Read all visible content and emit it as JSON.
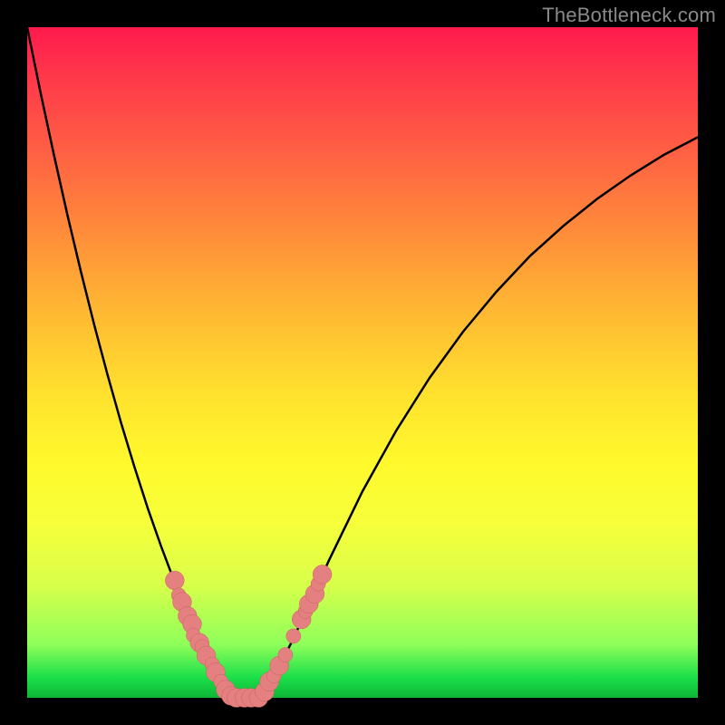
{
  "watermark": "TheBottleneck.com",
  "colors": {
    "page_bg": "#000000",
    "gradient_top": "#ff1a4d",
    "gradient_bottom": "#0db535",
    "curve": "#000000",
    "marker_fill": "#e58080",
    "marker_stroke": "#c96060"
  },
  "chart_data": {
    "type": "line",
    "title": "",
    "xlabel": "",
    "ylabel": "",
    "xlim": [
      0,
      100
    ],
    "ylim": [
      0,
      100
    ],
    "grid": false,
    "x": [
      0,
      2,
      4,
      6,
      8,
      10,
      12,
      14,
      16,
      18,
      20,
      22,
      24,
      25,
      26,
      28,
      30,
      31,
      32,
      33,
      34,
      35,
      36,
      38,
      40,
      42,
      45,
      50,
      55,
      60,
      65,
      70,
      75,
      80,
      85,
      90,
      95,
      100
    ],
    "y": [
      100,
      90.2,
      80.9,
      72.0,
      63.6,
      55.6,
      48.1,
      41.0,
      34.4,
      28.2,
      22.5,
      17.2,
      12.4,
      10.1,
      8.0,
      4.1,
      0.6,
      0.0,
      0.0,
      0.0,
      0.0,
      0.4,
      1.9,
      5.4,
      9.5,
      13.9,
      20.5,
      30.8,
      39.8,
      47.7,
      54.6,
      60.6,
      65.9,
      70.4,
      74.4,
      77.9,
      81.0,
      83.6
    ],
    "markers": [
      {
        "x": 22.0,
        "y": 17.5,
        "r": 1.4
      },
      {
        "x": 22.6,
        "y": 15.3,
        "r": 1.1
      },
      {
        "x": 23.1,
        "y": 14.3,
        "r": 1.4
      },
      {
        "x": 23.9,
        "y": 12.2,
        "r": 1.4
      },
      {
        "x": 24.6,
        "y": 11.0,
        "r": 1.4
      },
      {
        "x": 24.8,
        "y": 9.3,
        "r": 1.1
      },
      {
        "x": 25.7,
        "y": 8.2,
        "r": 1.4
      },
      {
        "x": 26.1,
        "y": 7.6,
        "r": 1.1
      },
      {
        "x": 26.7,
        "y": 6.3,
        "r": 1.4
      },
      {
        "x": 27.6,
        "y": 5.0,
        "r": 1.1
      },
      {
        "x": 28.1,
        "y": 3.8,
        "r": 1.4
      },
      {
        "x": 28.9,
        "y": 2.4,
        "r": 1.1
      },
      {
        "x": 29.6,
        "y": 1.2,
        "r": 1.4
      },
      {
        "x": 30.4,
        "y": 0.3,
        "r": 1.4
      },
      {
        "x": 31.2,
        "y": 0.0,
        "r": 1.4
      },
      {
        "x": 32.4,
        "y": 0.0,
        "r": 1.4
      },
      {
        "x": 33.4,
        "y": 0.0,
        "r": 1.4
      },
      {
        "x": 34.5,
        "y": 0.0,
        "r": 1.4
      },
      {
        "x": 35.4,
        "y": 0.9,
        "r": 1.4
      },
      {
        "x": 36.1,
        "y": 2.4,
        "r": 1.4
      },
      {
        "x": 36.8,
        "y": 3.3,
        "r": 1.1
      },
      {
        "x": 37.6,
        "y": 4.8,
        "r": 1.4
      },
      {
        "x": 38.5,
        "y": 6.4,
        "r": 1.1
      },
      {
        "x": 39.7,
        "y": 9.2,
        "r": 1.1
      },
      {
        "x": 40.9,
        "y": 11.7,
        "r": 1.4
      },
      {
        "x": 41.5,
        "y": 12.9,
        "r": 1.1
      },
      {
        "x": 42.0,
        "y": 14.0,
        "r": 1.4
      },
      {
        "x": 42.9,
        "y": 15.5,
        "r": 1.4
      },
      {
        "x": 43.4,
        "y": 17.0,
        "r": 1.1
      },
      {
        "x": 44.0,
        "y": 18.4,
        "r": 1.4
      }
    ]
  }
}
